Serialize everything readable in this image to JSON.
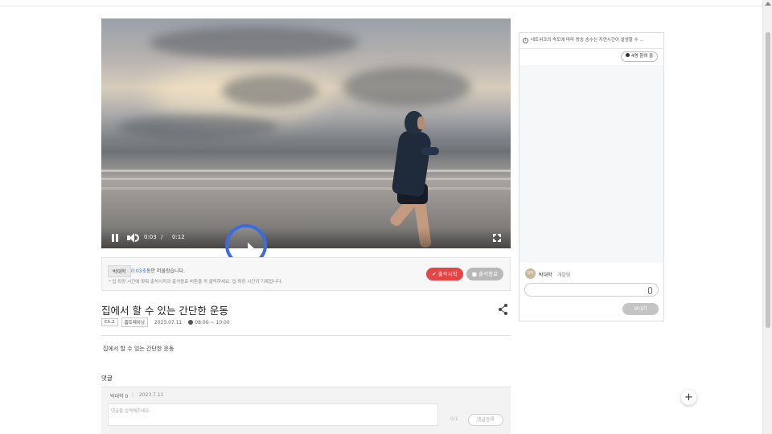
{
  "player": {
    "current_time": "0:03",
    "separator": "/",
    "total_time": "0:12"
  },
  "attendance": {
    "user_name": "박대학",
    "message_highlight": "0:03초",
    "message_rest": "동안 머물렀습니다.",
    "note": "* 입·퇴장 시간에 맞춰 출석시작과 출석종료 버튼을 꼭 클릭하세요. 입·퇴장 시간이 기록됩니다.",
    "start_label": "출석시작",
    "end_label": "출석종료"
  },
  "content": {
    "title": "집에서 할 수 있는 간단한 운동",
    "chapter": "Ch.2",
    "category": "홈트레이닝",
    "date": "2023.07.11",
    "time_range": "08:00 ~ 10:00",
    "description": "집에서 할 수 있는 간단한 운동"
  },
  "comments": {
    "title": "댓글",
    "user_label": "박대학 0",
    "separator": "|",
    "date": "2023.7.11",
    "input_placeholder": "댓글을 입력해주세요.",
    "count": "0/1",
    "submit_label": "댓글등록"
  },
  "chat": {
    "notice": "네트워크의 속도에 따라 방송 송수신 지연시간이 발생할 수 ...",
    "participants": "4명 참여 중",
    "user_avatar_text": "대학",
    "user_name": "박대학",
    "user_role": "개발팀",
    "input_value": "",
    "send_label": "보내기"
  },
  "fab": {
    "label": "+"
  },
  "colors": {
    "accent": "#3b6be0",
    "start_button": "#e54545",
    "end_button": "#b8b8b8"
  }
}
